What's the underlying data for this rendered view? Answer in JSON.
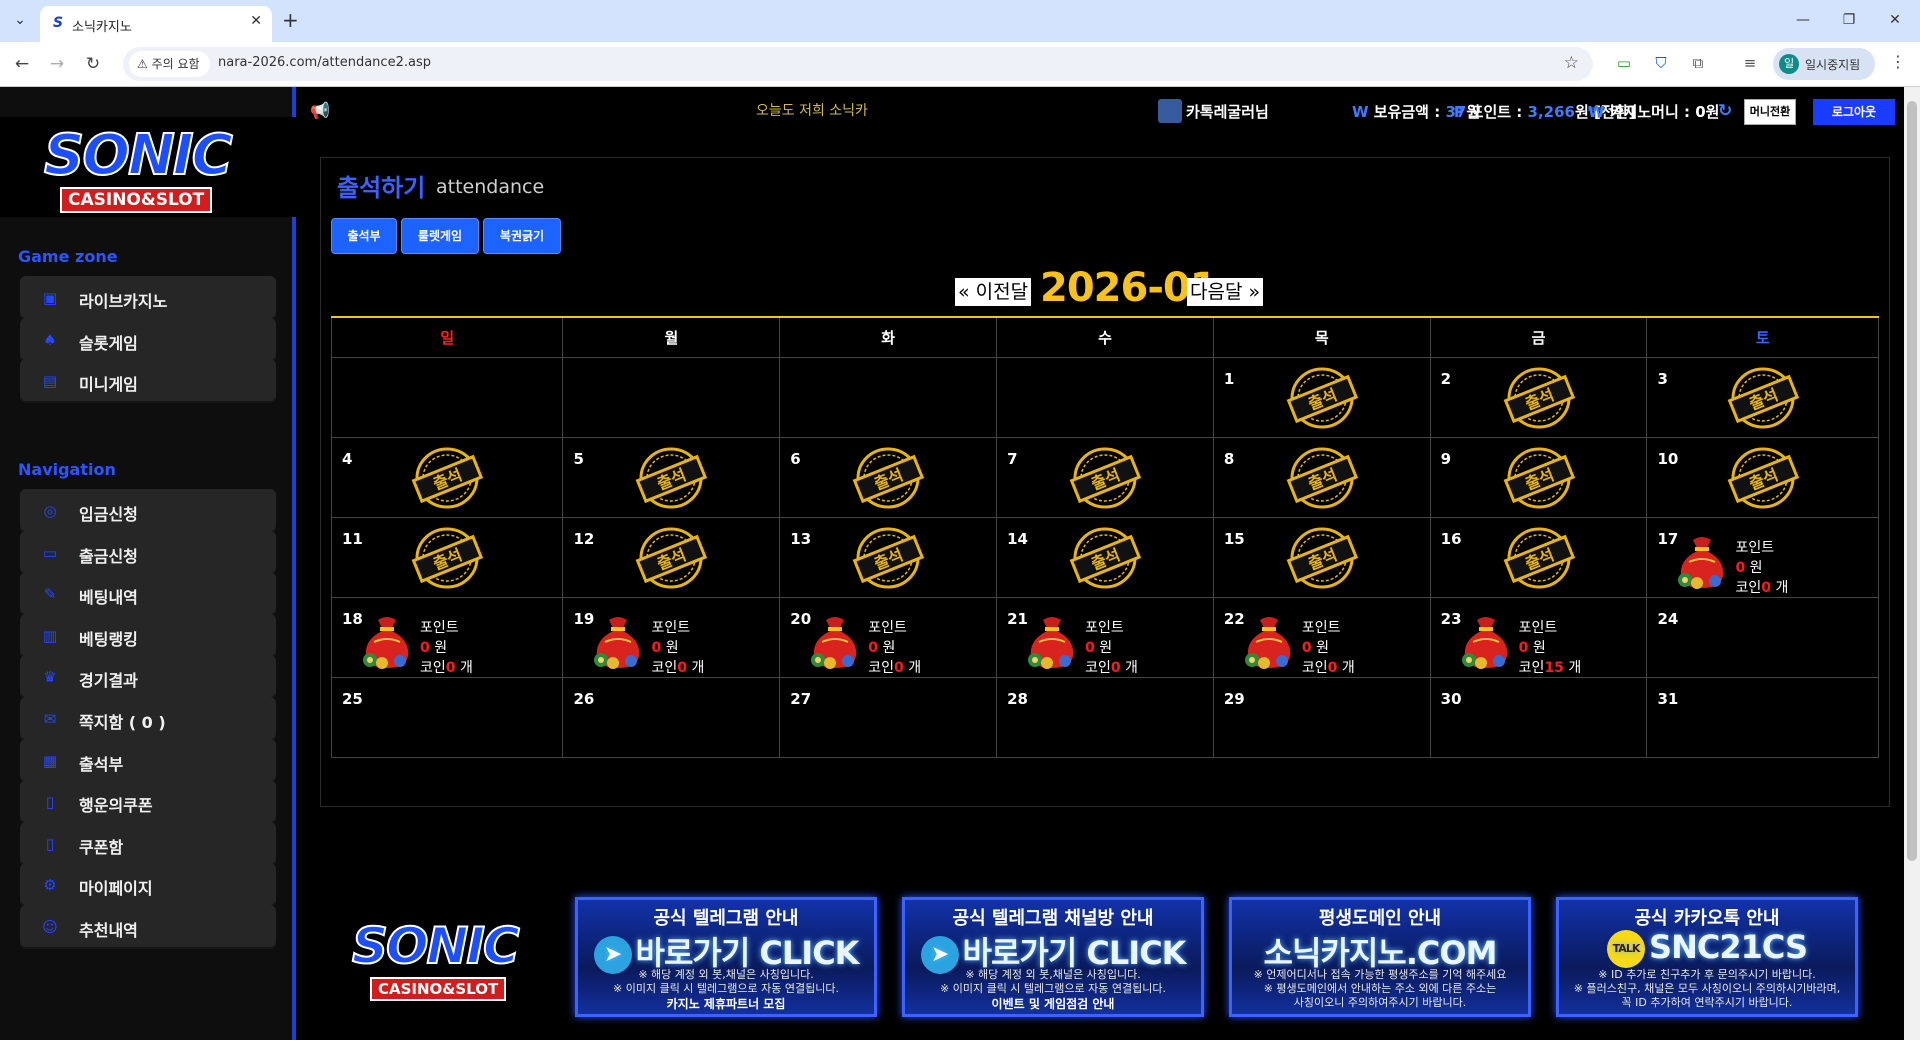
{
  "browser": {
    "tab_title": "소닉카지노",
    "tab_favicon": "S",
    "warning": "⚠ 주의 요함",
    "url": "nara-2026.com/attendance2.asp",
    "profile_initial": "일",
    "profile_name": "일시중지됨"
  },
  "sidebar": {
    "logo_main": "SONIC",
    "logo_sub": "CASINO&SLOT",
    "game_zone_title": "Game zone",
    "game_items": [
      {
        "label": "라이브카지노",
        "icon": "live-casino-icon"
      },
      {
        "label": "슬롯게임",
        "icon": "slot-icon"
      },
      {
        "label": "미니게임",
        "icon": "mini-game-icon"
      }
    ],
    "navigation_title": "Navigation",
    "nav_items": [
      {
        "label": "입금신청",
        "icon": "deposit-icon"
      },
      {
        "label": "출금신청",
        "icon": "withdraw-icon"
      },
      {
        "label": "베팅내역",
        "icon": "bet-history-icon"
      },
      {
        "label": "베팅랭킹",
        "icon": "bet-ranking-icon"
      },
      {
        "label": "경기결과",
        "icon": "match-result-icon"
      },
      {
        "label": "쪽지함 ( 0 )",
        "icon": "message-icon"
      },
      {
        "label": "출석부",
        "icon": "attendance-icon"
      },
      {
        "label": "행운의쿠폰",
        "icon": "lucky-coupon-icon"
      },
      {
        "label": "쿠폰함",
        "icon": "coupon-box-icon"
      },
      {
        "label": "마이페이지",
        "icon": "gear-icon"
      },
      {
        "label": "추천내역",
        "icon": "referral-icon"
      }
    ]
  },
  "topbar": {
    "notice": "오늘도 저희 소닉카",
    "user_name": "카톡레굴러님",
    "balance_label": "보유금액 :",
    "balance_value": "37",
    "balance_unit": "원",
    "point_label": "포인트 :",
    "point_value": "3,266",
    "point_unit": "원 [전환]",
    "casino_money_label": "카지노머니 : 0원",
    "money_transfer_button": "머니전환",
    "logout_button": "로그아웃"
  },
  "main": {
    "title": "출석하기",
    "title_en": "attendance",
    "sub_buttons": [
      "출석부",
      "룰렛게임",
      "복권긁기"
    ],
    "prev_month": "« 이전달",
    "month": "2026-01",
    "next_month": "다음달 »",
    "weekdays": [
      "일",
      "월",
      "화",
      "수",
      "목",
      "금",
      "토"
    ],
    "weekday_colors": {
      "sun": "#ff2020",
      "sat": "#2f6bff",
      "default": "#ffffff"
    },
    "stamp_text": "출석",
    "reward_point_label": "포인트",
    "reward_won_unit": "원",
    "reward_coin_label": "코인",
    "reward_coin_unit": "개",
    "weeks": [
      [
        {
          "d": ""
        },
        {
          "d": ""
        },
        {
          "d": ""
        },
        {
          "d": ""
        },
        {
          "d": "1",
          "type": "stamp"
        },
        {
          "d": "2",
          "type": "stamp"
        },
        {
          "d": "3",
          "type": "stamp"
        }
      ],
      [
        {
          "d": "4",
          "type": "stamp"
        },
        {
          "d": "5",
          "type": "stamp"
        },
        {
          "d": "6",
          "type": "stamp"
        },
        {
          "d": "7",
          "type": "stamp"
        },
        {
          "d": "8",
          "type": "stamp"
        },
        {
          "d": "9",
          "type": "stamp"
        },
        {
          "d": "10",
          "type": "stamp"
        }
      ],
      [
        {
          "d": "11",
          "type": "stamp"
        },
        {
          "d": "12",
          "type": "stamp"
        },
        {
          "d": "13",
          "type": "stamp"
        },
        {
          "d": "14",
          "type": "stamp"
        },
        {
          "d": "15",
          "type": "stamp"
        },
        {
          "d": "16",
          "type": "stamp"
        },
        {
          "d": "17",
          "type": "reward",
          "point": "0",
          "coin": "0"
        }
      ],
      [
        {
          "d": "18",
          "type": "reward",
          "point": "0",
          "coin": "0"
        },
        {
          "d": "19",
          "type": "reward",
          "point": "0",
          "coin": "0"
        },
        {
          "d": "20",
          "type": "reward",
          "point": "0",
          "coin": "0"
        },
        {
          "d": "21",
          "type": "reward",
          "point": "0",
          "coin": "0"
        },
        {
          "d": "22",
          "type": "reward",
          "point": "0",
          "coin": "0"
        },
        {
          "d": "23",
          "type": "reward",
          "point": "0",
          "coin": "15"
        },
        {
          "d": "24"
        }
      ],
      [
        {
          "d": "25"
        },
        {
          "d": "26"
        },
        {
          "d": "27"
        },
        {
          "d": "28"
        },
        {
          "d": "29"
        },
        {
          "d": "30"
        },
        {
          "d": "31"
        }
      ]
    ]
  },
  "footer": {
    "logo_main": "SONIC",
    "logo_sub": "CASINO&SLOT",
    "banners": [
      {
        "title": "공식 텔레그램 안내",
        "icon": "telegram-icon",
        "big": "바로가기 CLICK",
        "note": "※ 해당 계정 외 봇,채널은 사칭입니다.\n※ 이미지 클릭 시 텔레그램으로 자동 연결됩니다.",
        "foot": "카지노 제휴파트너 모집"
      },
      {
        "title": "공식 텔레그램 채널방 안내",
        "icon": "telegram-icon",
        "big": "바로가기 CLICK",
        "note": "※ 해당 계정 외 봇,채널은 사칭입니다.\n※ 이미지 클릭 시 텔레그램으로 자동 연결됩니다.",
        "foot": "이벤트 및 게임점검 안내"
      },
      {
        "title": "평생도메인 안내",
        "icon": "",
        "big": "소닉카지노.COM",
        "note": "※ 언제어디서나 접속 가능한 평생주소를 기억 해주세요\n※ 평생도메인에서 안내하는 주소 외에 다른 주소는\n사칭이오니 주의하여주시기 바랍니다.",
        "foot": ""
      },
      {
        "title": "공식 카카오톡 안내",
        "icon": "kakaotalk-icon",
        "big": "SNC21CS",
        "note": "※ ID 추가로 친구추가 후 문의주시기 바랍니다.\n※ 플러스친구, 채널은 모두 사칭이오니 주의하시기바라며,\n꼭 ID 추가하여 연락주시기 바랍니다.",
        "foot": ""
      }
    ]
  }
}
